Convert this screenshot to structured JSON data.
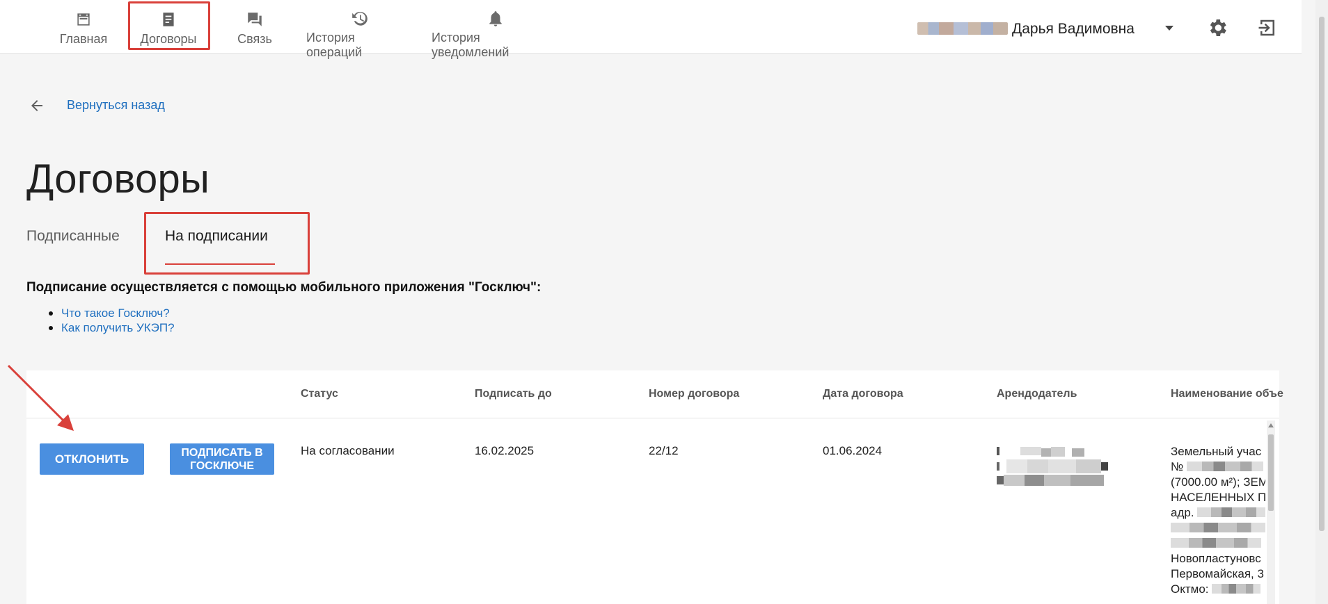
{
  "nav": {
    "items": [
      {
        "label": "Главная",
        "icon": "calendar-icon"
      },
      {
        "label": "Договоры",
        "icon": "document-icon",
        "active": true
      },
      {
        "label": "Связь",
        "icon": "chat-icon"
      },
      {
        "label": "История операций",
        "icon": "history-icon"
      },
      {
        "label": "История уведомлений",
        "icon": "bell-icon"
      }
    ],
    "user_name": "Дарья Вадимовна"
  },
  "back_link": "Вернуться назад",
  "page_title": "Договоры",
  "tabs": [
    {
      "label": "Подписанные"
    },
    {
      "label": "На подписании",
      "active": true
    }
  ],
  "info": {
    "heading": "Подписание осуществляется с помощью мобильного приложения \"Госключ\":",
    "links": [
      "Что такое Госключ?",
      "Как получить УКЭП?"
    ]
  },
  "table": {
    "columns": [
      "Статус",
      "Подписать до",
      "Номер договора",
      "Дата договора",
      "Арендодатель",
      "Наименование объе"
    ],
    "rows": [
      {
        "reject_label": "ОТКЛОНИТЬ",
        "sign_label": "ПОДПИСАТЬ В ГОСКЛЮЧЕ",
        "status": "На согласовании",
        "sign_until": "16.02.2025",
        "contract_number": "22/12",
        "contract_date": "01.06.2024",
        "object_lines": [
          "Земельный учас",
          "№ ",
          "(7000.00 м²); ЗЕМ",
          "НАСЕЛЕННЫХ ПУ",
          "адр. ",
          "",
          "",
          "Новопластуновс",
          "Первомайская, 3",
          "Октмо: "
        ]
      }
    ]
  },
  "colors": {
    "accent": "#4a8fe0",
    "link": "#1f6fbf",
    "highlight": "#d9403a"
  }
}
